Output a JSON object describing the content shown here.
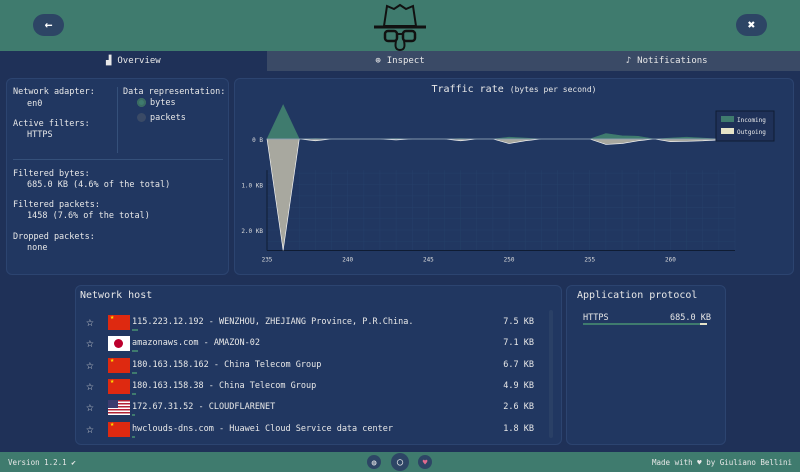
{
  "header": {
    "back_icon": "arrow-left-icon",
    "settings_icon": "wrench-screwdriver-icon",
    "logo": "sniffnet-detective-logo"
  },
  "tabs": [
    {
      "label": "Overview",
      "icon": "chart-icon",
      "active": true
    },
    {
      "label": "Inspect",
      "icon": "magnifier-icon"
    },
    {
      "label": "Notifications",
      "icon": "bell-icon"
    }
  ],
  "info": {
    "adapter_label": "Network adapter:",
    "adapter_value": "en0",
    "filters_label": "Active filters:",
    "filters_value": "HTTPS",
    "repr_label": "Data representation:",
    "repr_options": [
      "bytes",
      "packets"
    ],
    "repr_selected": "bytes",
    "bytes_label": "Filtered bytes:",
    "bytes_value": "685.0 KB (4.6% of the total)",
    "packets_label": "Filtered packets:",
    "packets_value": "1458 (7.6% of the total)",
    "dropped_label": "Dropped packets:",
    "dropped_value": "none"
  },
  "chart_data": {
    "type": "area",
    "title": "Traffic rate",
    "subtitle": "(bytes per second)",
    "xlim": [
      235,
      264
    ],
    "ylim": [
      -0.75,
      2.45
    ],
    "x_ticks": [
      "235",
      "240",
      "245",
      "250",
      "255",
      "260"
    ],
    "y_ticks": [
      "0 B",
      "1.0 KB",
      "2.0 KB"
    ],
    "legend": "top-right",
    "grid": true,
    "x": [
      235,
      236,
      237,
      238,
      239,
      240,
      241,
      242,
      243,
      244,
      245,
      246,
      247,
      248,
      249,
      250,
      251,
      252,
      253,
      254,
      255,
      256,
      257,
      258,
      259,
      260,
      261,
      262,
      263,
      264
    ],
    "series": [
      {
        "name": "Incoming",
        "color": "#3f7b6e",
        "unit": "KB",
        "values": [
          0,
          0.75,
          0,
          0.01,
          0,
          0,
          0,
          0,
          0.01,
          0,
          0,
          0,
          0.01,
          0,
          0,
          0.04,
          0.02,
          0,
          0,
          0,
          0,
          0.12,
          0.07,
          0.06,
          0,
          0.02,
          0.04,
          0.02,
          0,
          0
        ]
      },
      {
        "name": "Outgoing",
        "color": "#e6e3c8",
        "unit": "KB",
        "values": [
          0,
          2.45,
          0,
          0.04,
          0,
          0,
          0,
          0,
          0.02,
          0,
          0,
          0,
          0.04,
          0,
          0,
          0.1,
          0.04,
          0,
          0,
          0,
          0,
          0.12,
          0.1,
          0.04,
          0,
          0.06,
          0.05,
          0.04,
          0.02,
          0
        ]
      }
    ]
  },
  "hosts": {
    "title": "Network host",
    "rows": [
      {
        "flag": "cn",
        "text": "115.223.12.192 - WENZHOU, ZHEJIANG Province, P.R.China.",
        "value": "7.5 KB",
        "fraction": 1
      },
      {
        "flag": "jp",
        "text": "amazonaws.com - AMAZON-02",
        "value": "7.1 KB",
        "fraction": 0.95
      },
      {
        "flag": "cn",
        "text": "180.163.158.162 - China Telecom Group",
        "value": "6.7 KB",
        "fraction": 0.89
      },
      {
        "flag": "cn",
        "text": "180.163.158.38 - China Telecom Group",
        "value": "4.9 KB",
        "fraction": 0.65
      },
      {
        "flag": "us",
        "text": "172.67.31.52 - CLOUDFLARENET",
        "value": "2.6 KB",
        "fraction": 0.35
      },
      {
        "flag": "cn",
        "text": "hwclouds-dns.com - Huawei Cloud Service data center",
        "value": "1.8 KB",
        "fraction": 0.24
      }
    ]
  },
  "protocols": {
    "title": "Application protocol",
    "rows": [
      {
        "name": "HTTPS",
        "value": "685.0 KB",
        "incoming_fraction": 0.94
      }
    ]
  },
  "footer": {
    "version": "Version 1.2.1",
    "made_with": "Made with ♥ by Giuliano Bellini"
  }
}
